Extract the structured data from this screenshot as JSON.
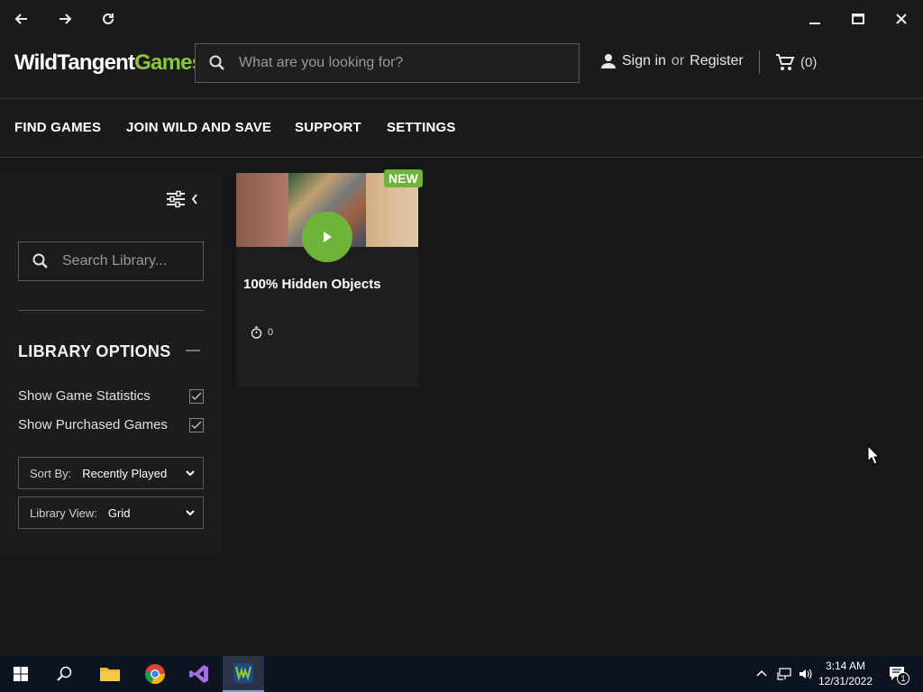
{
  "header": {
    "logo_wild": "WildTangent",
    "logo_games": "Games",
    "search_placeholder": "What are you looking for?",
    "sign_in": "Sign in",
    "or": "or",
    "register": "Register",
    "cart_count": "(0)"
  },
  "nav": {
    "items": [
      "FIND GAMES",
      "JOIN WILD AND SAVE",
      "SUPPORT",
      "SETTINGS"
    ]
  },
  "sidebar": {
    "search_placeholder": "Search Library...",
    "options_title": "LIBRARY OPTIONS",
    "show_stats": "Show Game Statistics",
    "show_purchased": "Show Purchased Games",
    "sort_label": "Sort By:",
    "sort_value": "Recently Played",
    "view_label": "Library View:",
    "view_value": "Grid"
  },
  "game": {
    "title": "100% Hidden Objects",
    "badge": "NEW",
    "play_time": "0"
  },
  "taskbar": {
    "time": "3:14 AM",
    "date": "12/31/2022",
    "notifications": "1"
  },
  "colors": {
    "accent_green": "#6fb43a",
    "background": "#171717"
  }
}
